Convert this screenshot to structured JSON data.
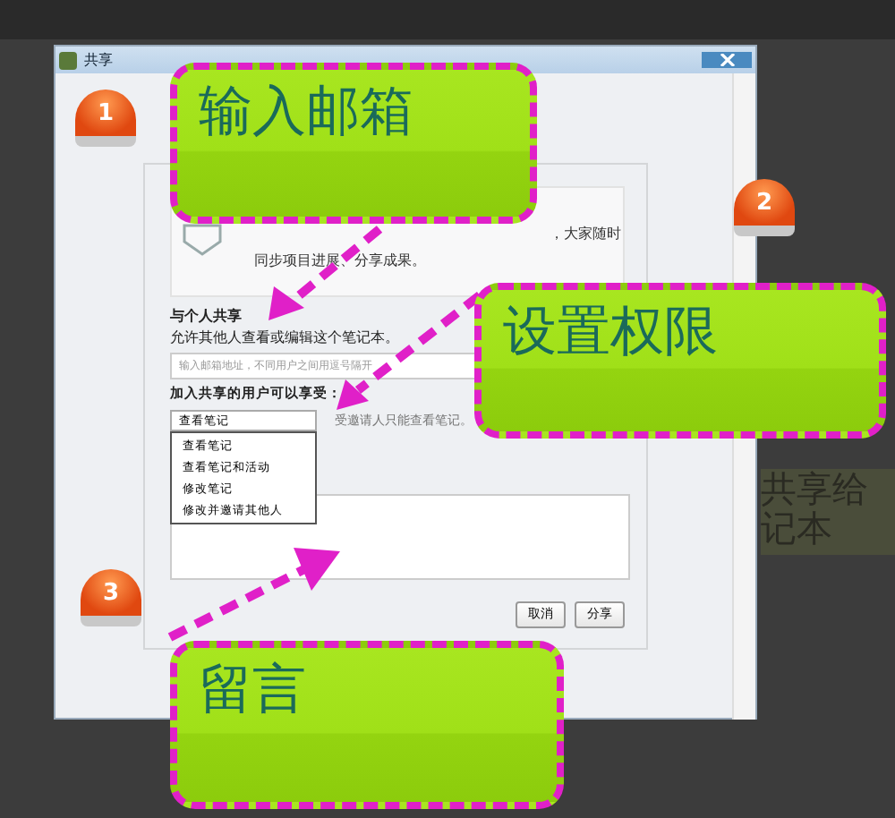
{
  "window": {
    "title": "共享"
  },
  "dialog": {
    "intro": [
      "，大家随时",
      "同步项目进展、分享成果。"
    ],
    "section_title": "与个人共享",
    "section_desc": "允许其他人查看或编辑这个笔记本。",
    "email_field": {
      "placeholder": "输入邮箱地址，不同用户之间用逗号隔开"
    },
    "permission_label": "加入共享的用户可以享受：",
    "permission_select": {
      "value": "查看笔记",
      "expanded": true,
      "options": [
        "查看笔记",
        "查看笔记和活动",
        "修改笔记",
        "修改并邀请其他人"
      ]
    },
    "permission_hint": "受邀请人只能查看笔记。",
    "buttons": [
      "取消",
      "分享"
    ]
  },
  "background_text": [
    "共享给",
    "记本"
  ],
  "callouts": [
    {
      "number": "1",
      "label": "输入邮箱"
    },
    {
      "number": "2",
      "label": "设置权限"
    },
    {
      "number": "3",
      "label": "留言"
    }
  ]
}
